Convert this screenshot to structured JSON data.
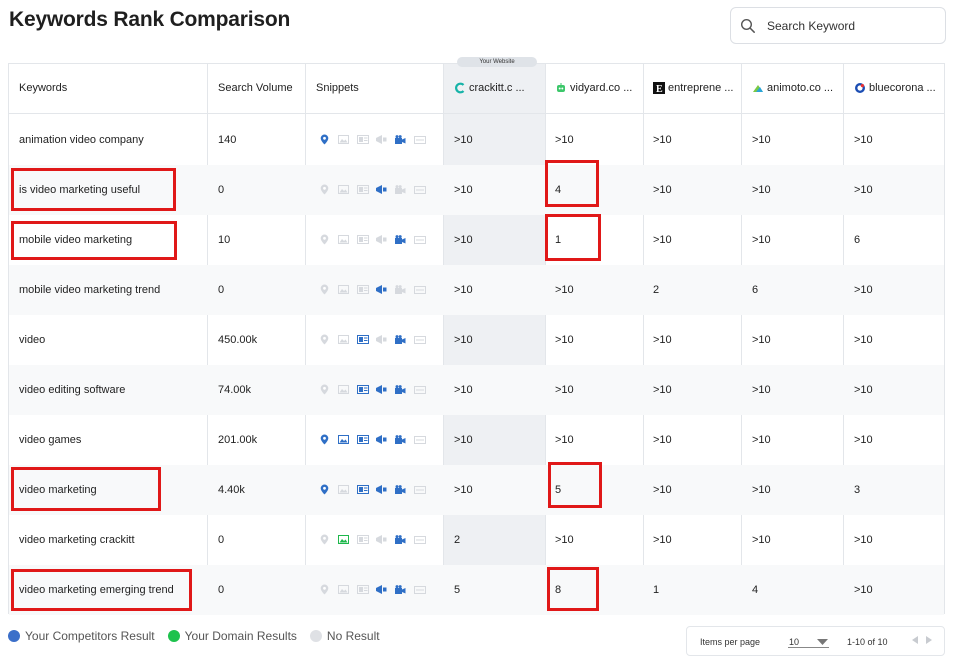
{
  "title": "Keywords Rank Comparison",
  "search": {
    "placeholder": "Search Keyword"
  },
  "badge": "Your Website",
  "table": {
    "headers": {
      "keywords": "Keywords",
      "volume": "Search Volume",
      "snippets": "Snippets",
      "competitors": [
        "crackitt.c ...",
        "vidyard.co ...",
        "entreprene ...",
        "animoto.co ...",
        "bluecorona ..."
      ]
    },
    "rows": [
      {
        "keyword": "animation video company",
        "volume": "140",
        "ranks": [
          ">10",
          ">10",
          ">10",
          ">10",
          ">10"
        ]
      },
      {
        "keyword": "is video marketing useful",
        "volume": "0",
        "ranks": [
          ">10",
          "4",
          ">10",
          ">10",
          ">10"
        ]
      },
      {
        "keyword": "mobile video marketing",
        "volume": "10",
        "ranks": [
          ">10",
          "1",
          ">10",
          ">10",
          "6"
        ]
      },
      {
        "keyword": "mobile video marketing trend",
        "volume": "0",
        "ranks": [
          ">10",
          ">10",
          "2",
          "6",
          ">10"
        ]
      },
      {
        "keyword": "video",
        "volume": "450.00k",
        "ranks": [
          ">10",
          ">10",
          ">10",
          ">10",
          ">10"
        ]
      },
      {
        "keyword": "video editing software",
        "volume": "74.00k",
        "ranks": [
          ">10",
          ">10",
          ">10",
          ">10",
          ">10"
        ]
      },
      {
        "keyword": "video games",
        "volume": "201.00k",
        "ranks": [
          ">10",
          ">10",
          ">10",
          ">10",
          ">10"
        ]
      },
      {
        "keyword": "video marketing",
        "volume": "4.40k",
        "ranks": [
          ">10",
          "5",
          ">10",
          ">10",
          "3"
        ]
      },
      {
        "keyword": "video marketing crackitt",
        "volume": "0",
        "ranks": [
          "2",
          ">10",
          ">10",
          ">10",
          ">10"
        ]
      },
      {
        "keyword": "video marketing emerging trend",
        "volume": "0",
        "ranks": [
          "5",
          "8",
          "1",
          "4",
          ">10"
        ]
      }
    ],
    "snippet_icons": [
      "location-pin-icon",
      "image-icon",
      "featured-snippet-icon",
      "news-icon",
      "video-icon",
      "ad-icon"
    ],
    "snippet_states": [
      [
        "blue",
        "none",
        "none",
        "none",
        "blue",
        "none"
      ],
      [
        "none",
        "none",
        "none",
        "blue",
        "none",
        "none"
      ],
      [
        "none",
        "none",
        "none",
        "none",
        "blue",
        "none"
      ],
      [
        "none",
        "none",
        "none",
        "blue",
        "none",
        "none"
      ],
      [
        "none",
        "none",
        "blue",
        "none",
        "blue",
        "none"
      ],
      [
        "none",
        "none",
        "blue",
        "blue",
        "blue",
        "none"
      ],
      [
        "blue",
        "blue",
        "blue",
        "blue",
        "blue",
        "none"
      ],
      [
        "blue",
        "none",
        "blue",
        "blue",
        "blue",
        "none"
      ],
      [
        "none",
        "green",
        "none",
        "none",
        "blue",
        "none"
      ],
      [
        "none",
        "none",
        "none",
        "blue",
        "blue",
        "none"
      ]
    ]
  },
  "legend": {
    "competitors": "Your Competitors Result",
    "domain": "Your Domain Results",
    "none": "No Result"
  },
  "pagination": {
    "items_label": "Items per page",
    "items_value": "10",
    "range": "1-10 of 10"
  },
  "colors": {
    "blue": "#2f6fc6",
    "green": "#1eb84c",
    "grey": "#d6d9de",
    "highlight": "#e01818"
  }
}
